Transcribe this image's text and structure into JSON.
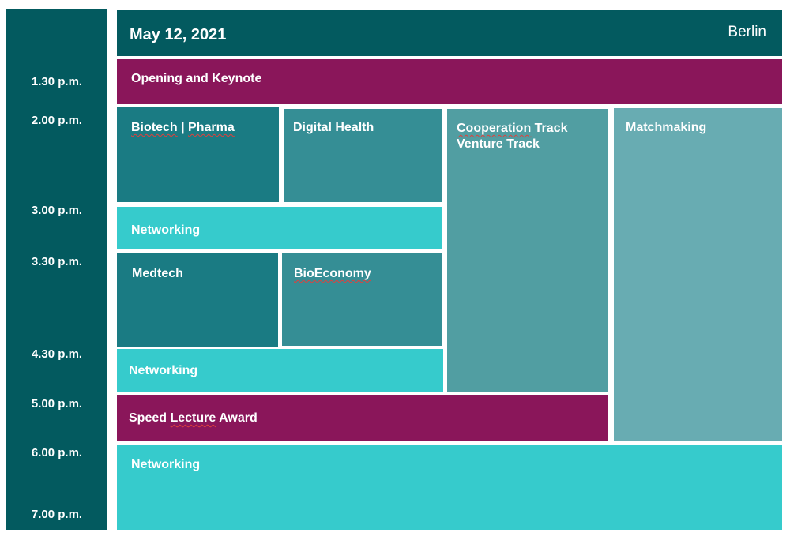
{
  "header": {
    "date": "May 12, 2021",
    "city": "Berlin"
  },
  "times": [
    "1.30 p.m.",
    "2.00 p.m.",
    "3.00 p.m.",
    "3.30 p.m.",
    "4.30 p.m.",
    "5.00 p.m.",
    "6.00 p.m.",
    "7.00 p.m."
  ],
  "sessions": {
    "opening": "Opening and Keynote",
    "biotech_a": "Biotech",
    "biotech_sep": " | ",
    "biotech_b": "Pharma",
    "digital_health": "Digital Health",
    "cooperation": "Cooperation",
    "cooperation_rest": " Track",
    "venture": "Venture Track",
    "matchmaking": "Matchmaking",
    "networking_1": "Networking",
    "medtech": "Medtech",
    "bioeconomy": "BioEconomy",
    "networking_2": "Networking",
    "speed_a": "Speed ",
    "speed_b": "Lecture",
    "speed_c": " Award",
    "networking_3": "Networking"
  },
  "colors": {
    "dark_teal": "#035a5f",
    "magenta": "#8a165a",
    "teal": "#1a7b83",
    "teal_mid": "#358e95",
    "teal_track": "#519ea2",
    "teal_light": "#68acb2",
    "cyan": "#36cbcc"
  }
}
